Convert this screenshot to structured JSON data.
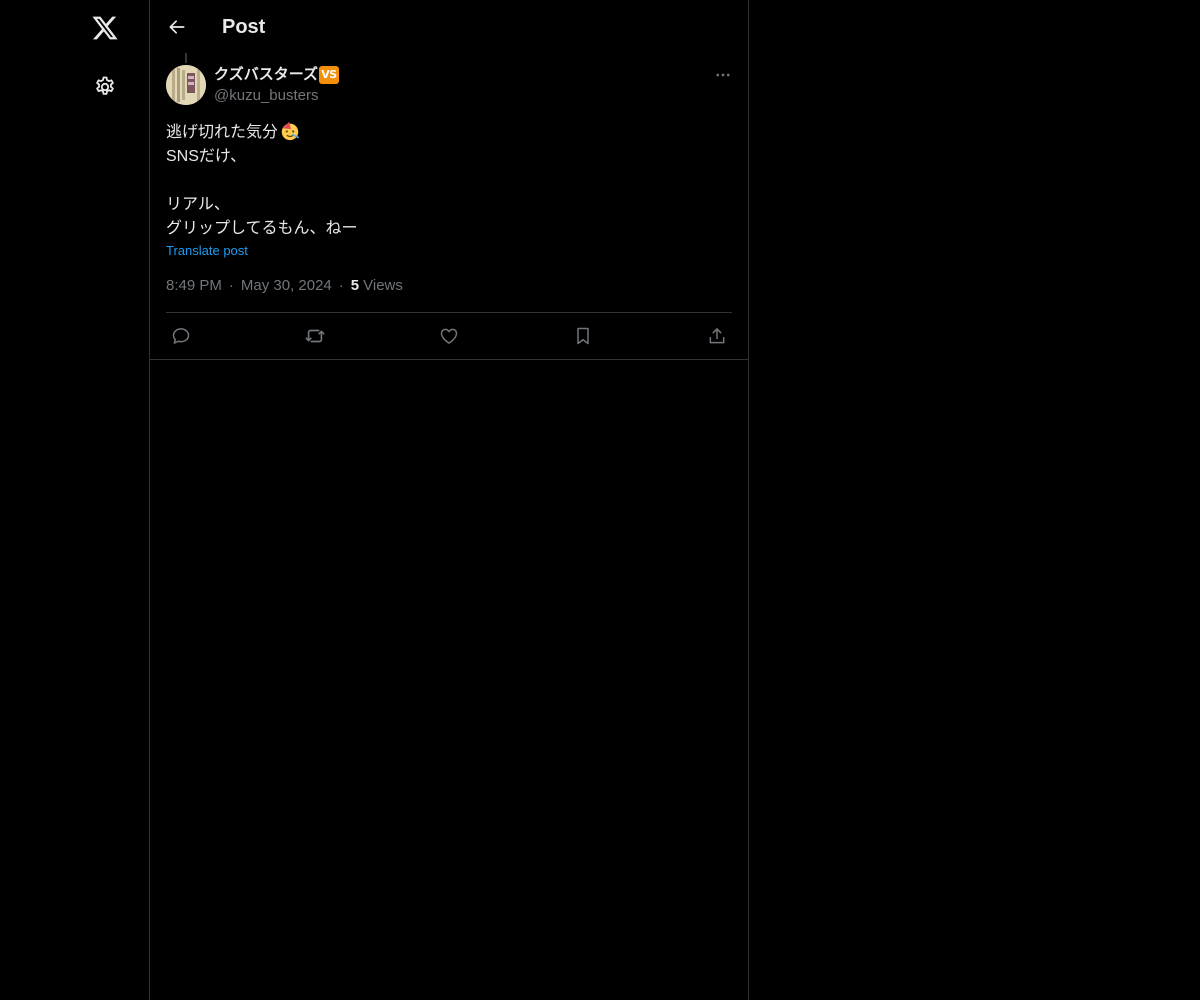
{
  "header": {
    "title": "Post"
  },
  "post": {
    "author": {
      "name": "クズバスターズ",
      "badge": "VS",
      "handle": "@kuzu_busters"
    },
    "text_lines": [
      "逃げ切れた気分",
      "SNSだけ、",
      "",
      "リアル、",
      "グリップしてるもん、ねー"
    ],
    "translate_label": "Translate post",
    "time": "8:49 PM",
    "separator": "·",
    "date": "May 30, 2024",
    "views_count": "5",
    "views_label": "Views"
  },
  "icons": {
    "logo": "x-logo-icon",
    "settings": "gear-icon",
    "back": "arrow-left-icon",
    "more": "more-dots-icon",
    "reply": "reply-icon",
    "repost": "repost-icon",
    "like": "heart-icon",
    "bookmark": "bookmark-icon",
    "share": "share-icon",
    "emoji": "partying-face-emoji"
  },
  "colors": {
    "background": "#000000",
    "text_primary": "#e7e9ea",
    "text_secondary": "#71767b",
    "border": "#2f3336",
    "link": "#1d9bf0",
    "badge": "#f4900c"
  }
}
